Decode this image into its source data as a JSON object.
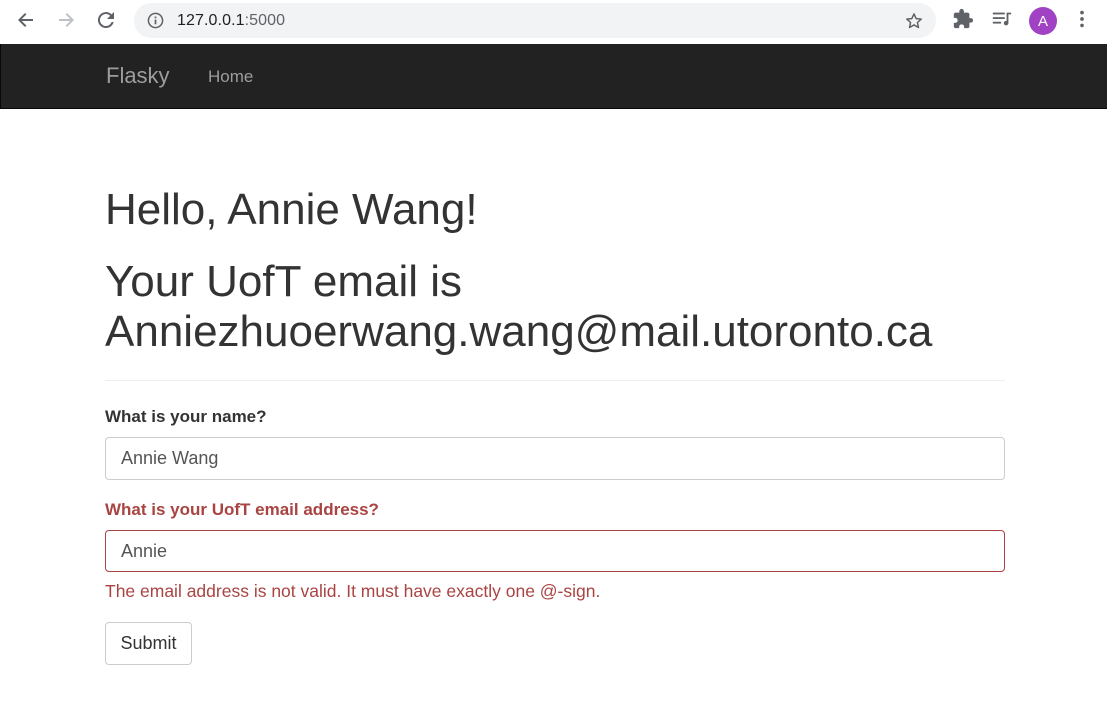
{
  "browser": {
    "url_host": "127.0.0.1",
    "url_port": ":5000",
    "avatar_letter": "A",
    "avatar_color": "#a142c4",
    "icons": [
      "back-arrow-icon",
      "forward-arrow-icon",
      "reload-icon",
      "info-icon",
      "star-icon",
      "puzzle-icon",
      "media-queue-icon",
      "kebab-menu-icon"
    ]
  },
  "navbar": {
    "brand": "Flasky",
    "items": [
      {
        "label": "Home"
      }
    ]
  },
  "main": {
    "greeting": "Hello, Annie Wang!",
    "email_line": "Your UofT email is Anniezhuoerwang.wang@mail.utoronto.ca"
  },
  "form": {
    "name_label": "What is your name?",
    "name_value": "Annie Wang",
    "email_label": "What is your UofT email address?",
    "email_value": "Annie",
    "email_error": "The email address is not valid. It must have exactly one @-sign.",
    "submit_label": "Submit"
  },
  "colors": {
    "navbar_bg": "#222222",
    "error": "#a94442"
  }
}
